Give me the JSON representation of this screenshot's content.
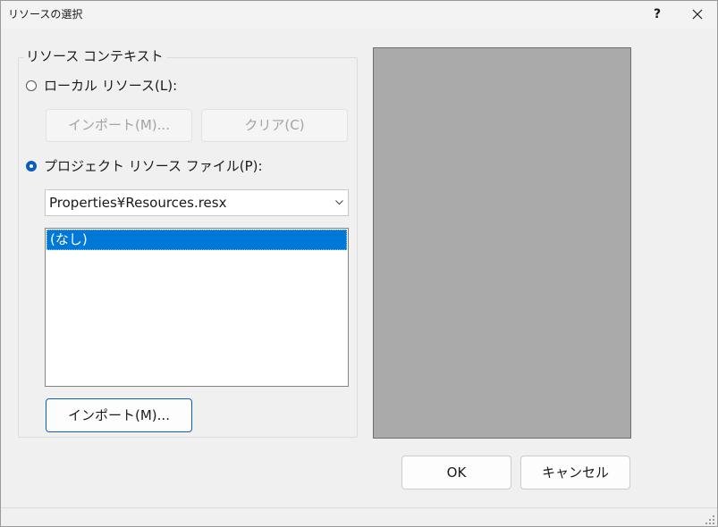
{
  "window": {
    "title": "リソースの選択",
    "help_label": "?",
    "close_icon": "close-icon"
  },
  "context": {
    "group_label": "リソース コンテキスト",
    "local": {
      "label": "ローカル リソース(L):",
      "selected": false,
      "import_label": "インポート(M)...",
      "clear_label": "クリア(C)"
    },
    "project": {
      "label": "プロジェクト リソース ファイル(P):",
      "selected": true,
      "file_value": "Properties¥Resources.resx",
      "list_items": [
        "(なし)"
      ],
      "selected_index": 0,
      "import_label": "インポート(M)..."
    }
  },
  "footer": {
    "ok_label": "OK",
    "cancel_label": "キャンセル"
  },
  "colors": {
    "accent": "#0a5fbe",
    "selection": "#0078d7",
    "preview_bg": "#aaaaaa",
    "dialog_bg": "#f0f0f0"
  }
}
